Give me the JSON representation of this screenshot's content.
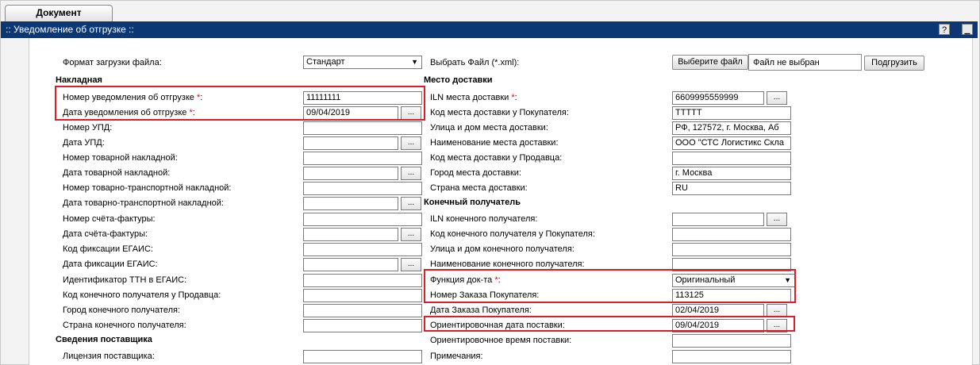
{
  "tab": {
    "label": "Документ"
  },
  "panel": {
    "title": ":: Уведомление об отгрузке ::",
    "help_label": "?",
    "minimize_label": "▁"
  },
  "format": {
    "label": "Формат загрузки файла:",
    "value": "Стандарт"
  },
  "file": {
    "label": "Выбрать Файл (*.xml):",
    "choose_label": "Выберите файл",
    "status": "Файл не выбран",
    "upload_label": "Подгрузить"
  },
  "sections": {
    "waybill": "Накладная",
    "delivery": "Место доставки",
    "recipient": "Конечный получатель",
    "supplier": "Сведения поставщика"
  },
  "left_fields": [
    {
      "label": "Номер уведомления об отгрузке ",
      "required": "*",
      "value": "11111111"
    },
    {
      "label": "Дата уведомления об отгрузке ",
      "required": "*",
      "value": "09/04/2019"
    },
    {
      "label": "Номер УПД:",
      "value": ""
    },
    {
      "label": "Дата УПД:",
      "value": ""
    },
    {
      "label": "Номер товарной накладной:",
      "value": ""
    },
    {
      "label": "Дата товарной накладной:",
      "value": ""
    },
    {
      "label": "Номер товарно-транспортной накладной:",
      "value": ""
    },
    {
      "label": "Дата товарно-транспортной накладной:",
      "value": ""
    },
    {
      "label": "Номер счёта-фактуры:",
      "value": ""
    },
    {
      "label": "Дата счёта-фактуры:",
      "value": ""
    },
    {
      "label": "Код фиксации ЕГАИС:",
      "value": ""
    },
    {
      "label": "Дата фиксации ЕГАИС:",
      "value": ""
    },
    {
      "label": "Идентификатор ТТН в ЕГАИС:",
      "value": ""
    },
    {
      "label": "Код конечного получателя у Продавца:",
      "value": ""
    },
    {
      "label": "Город конечного получателя:",
      "value": ""
    },
    {
      "label": "Страна конечного получателя:",
      "value": ""
    },
    {
      "label": "Лицензия поставщика:",
      "value": ""
    }
  ],
  "right_fields": [
    {
      "label": "ILN места доставки ",
      "required": "*",
      "value": "6609995559999"
    },
    {
      "label": "Код места доставки у Покупателя:",
      "value": "ТТТТТ"
    },
    {
      "label": "Улица и дом места доставки:",
      "value": "РФ, 127572, г. Москва, Аб"
    },
    {
      "label": "Наименование места доставки:",
      "value": "ООО \"СТС Логистикс Скла"
    },
    {
      "label": "Код места доставки у Продавца:",
      "value": ""
    },
    {
      "label": "Город места доставки:",
      "value": "г. Москва"
    },
    {
      "label": "Страна места доставки:",
      "value": "RU"
    },
    {
      "label": "ILN конечного получателя:",
      "value": ""
    },
    {
      "label": "Код конечного получателя у Покупателя:",
      "value": ""
    },
    {
      "label": "Улица и дом конечного получателя:",
      "value": ""
    },
    {
      "label": "Наименование конечного получателя:",
      "value": ""
    },
    {
      "label": "Функция док-та ",
      "required": "*",
      "value": "Оригинальный"
    },
    {
      "label": "Номер Заказа Покупателя:",
      "value": "113125"
    },
    {
      "label": "Дата Заказа Покупателя:",
      "value": "02/04/2019"
    },
    {
      "label": "Ориентировочная дата поставки:",
      "value": "09/04/2019"
    },
    {
      "label": "Ориентировочное время поставки:",
      "value": ""
    },
    {
      "label": "Примечания:",
      "value": ""
    }
  ],
  "lookup_button_label": "...",
  "colors": {
    "titlebar": "#0b3775",
    "highlight": "#d9202a",
    "required": "#e0001b"
  }
}
